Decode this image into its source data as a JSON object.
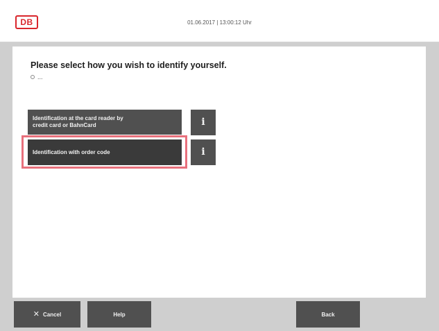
{
  "header": {
    "logo_text": "DB",
    "datetime": "01.06.2017 | 13:00:12 Uhr"
  },
  "main": {
    "heading": "Please select how you wish to identify yourself.",
    "sub_text": "...",
    "options": [
      {
        "label_line1": "Identification at the card reader by",
        "label_line2": "credit card or BahnCard",
        "info_label": "i"
      },
      {
        "label": "Identification with order code",
        "info_label": "i",
        "highlighted": true
      }
    ]
  },
  "footer": {
    "cancel_label": "Cancel",
    "cancel_icon": "close-icon",
    "help_label": "Help",
    "back_label": "Back"
  },
  "colors": {
    "brand_red": "#d9262c",
    "button_gray": "#505050",
    "highlight": "#e8707c",
    "frame_gray": "#cfcfcf"
  }
}
